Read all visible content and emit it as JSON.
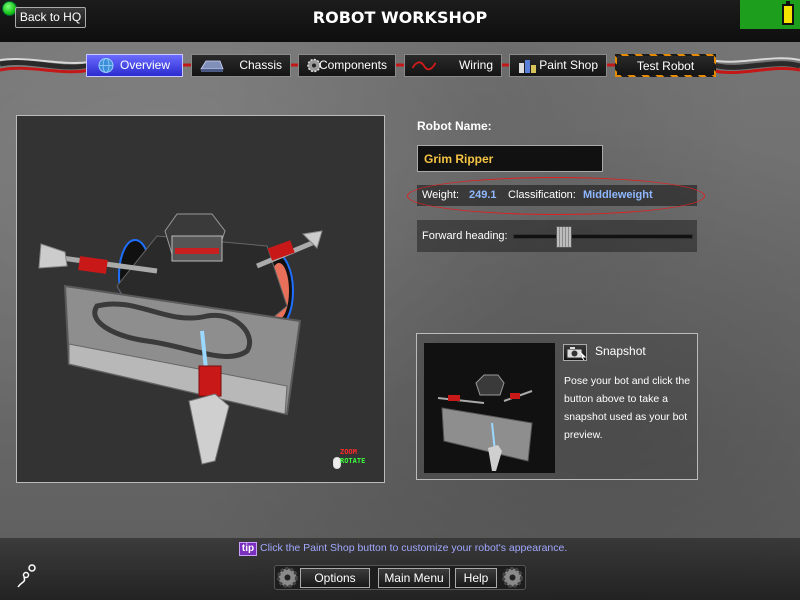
{
  "header": {
    "back_label": "Back to HQ",
    "title": "ROBOT WORKSHOP"
  },
  "tabs": [
    {
      "label": "Overview",
      "icon": "globe-icon",
      "active": true
    },
    {
      "label": "Chassis",
      "icon": "chassis-icon",
      "active": false
    },
    {
      "label": "Components",
      "icon": "gear-icon",
      "active": false
    },
    {
      "label": "Wiring",
      "icon": "wire-icon",
      "active": false
    },
    {
      "label": "Paint Shop",
      "icon": "paint-cans-icon",
      "active": false
    },
    {
      "label": "Test Robot",
      "icon": "",
      "active": false
    }
  ],
  "viewport": {
    "zoom_hint": "ZOOM",
    "rotate_hint": "ROTATE"
  },
  "robot": {
    "name_label": "Robot Name:",
    "name_value": "Grim Ripper",
    "weight_label": "Weight:",
    "weight_value": "249.1",
    "class_label": "Classification:",
    "class_value": "Middleweight",
    "heading_label": "Forward heading:",
    "heading_level": 0.26
  },
  "snapshot": {
    "title": "Snapshot",
    "description": "Pose your bot and click the button above to take a snapshot used as your bot preview."
  },
  "footer": {
    "tip_badge": "tip",
    "tip_text": "Click the Paint Shop button to customize your robot's appearance.",
    "options_label": "Options",
    "main_menu_label": "Main Menu",
    "help_label": "Help"
  },
  "colors": {
    "accent_blue": "#4b4bff",
    "name_gold": "#f5c445",
    "stat_blue": "#8fb8ff",
    "status_green": "#1d9e1d",
    "tip_purple": "#7a2fbf"
  }
}
